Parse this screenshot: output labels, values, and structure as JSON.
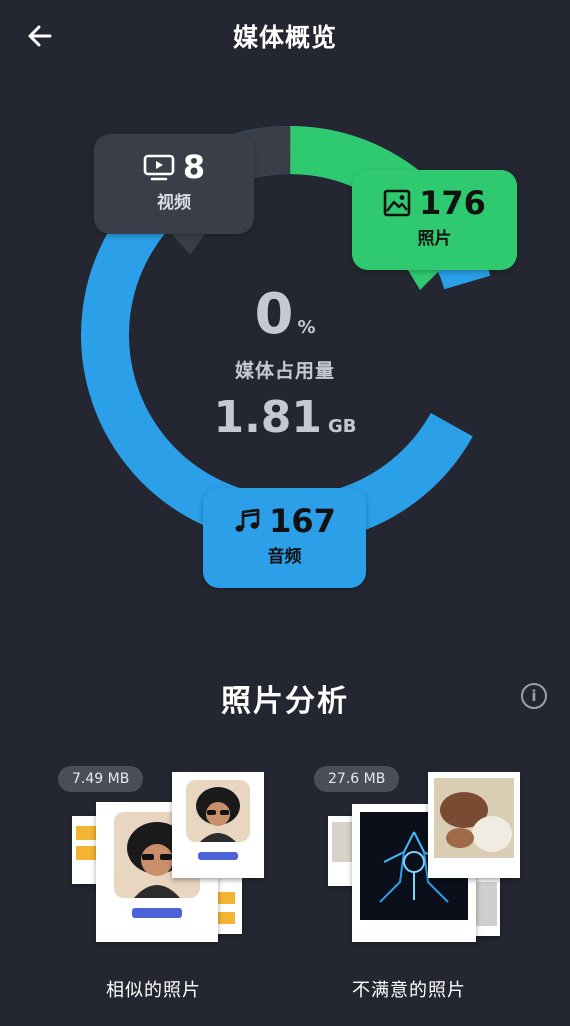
{
  "header": {
    "title": "媒体概览",
    "back_icon": "arrow-left-icon"
  },
  "overview": {
    "percent_value": "0",
    "percent_unit": "%",
    "label": "媒体占用量",
    "size_value": "1.81",
    "size_unit": "GB",
    "colors": {
      "video": "#3a3e48",
      "photo": "#2fca70",
      "audio": "#2b9fe8"
    },
    "video": {
      "icon": "tv-icon",
      "count": "8",
      "label": "视频"
    },
    "photo": {
      "icon": "image-icon",
      "count": "176",
      "label": "照片"
    },
    "audio": {
      "icon": "music-note-icon",
      "count": "167",
      "label": "音频"
    }
  },
  "analysis": {
    "title": "照片分析",
    "info_icon": "info-icon",
    "info_glyph": "i",
    "similar": {
      "size": "7.49 MB",
      "label": "相似的照片"
    },
    "unsatisfied": {
      "size": "27.6 MB",
      "label": "不满意的照片"
    }
  }
}
